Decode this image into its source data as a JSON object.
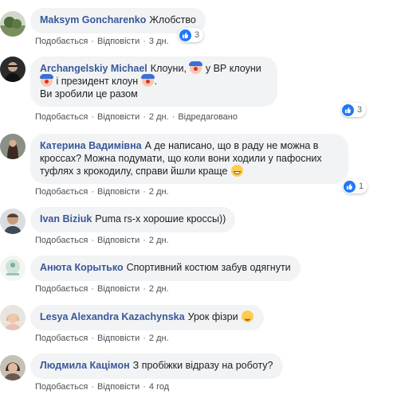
{
  "comments": [
    {
      "author": "Maksym Goncharenko",
      "text": "Жлобство",
      "like_label": "Подобається",
      "reply_label": "Відповісти",
      "time": "3 дн.",
      "reaction_count": "3"
    },
    {
      "author": "Archangelskiy Michael",
      "text_parts": [
        "Клоуни, ",
        " у ВР клоуни ",
        " і президент клоун ",
        "."
      ],
      "text_line2": "Ви зробили це разом",
      "like_label": "Подобається",
      "reply_label": "Відповісти",
      "time": "2 дн.",
      "edited_label": "Відредаговано",
      "reaction_count": "3"
    },
    {
      "author": "Катерина Вадимівна",
      "text": "А де написано, що в раду не можна в кроссах? Можна подумати, що коли вони ходили у пафосних туфлях з крокодилу, справи йшли краще",
      "like_label": "Подобається",
      "reply_label": "Відповісти",
      "time": "2 дн.",
      "reaction_count": "1"
    },
    {
      "author": "Ivan Biziuk",
      "text": "Puma rs-x хорошие кроссы))",
      "like_label": "Подобається",
      "reply_label": "Відповісти",
      "time": "2 дн."
    },
    {
      "author": "Анюта Корытько",
      "text": "Спортивний костюм забув одягнути",
      "like_label": "Подобається",
      "reply_label": "Відповісти",
      "time": "2 дн."
    },
    {
      "author": "Lesya Alexandra Kazachynska",
      "text": "Урок фізри",
      "like_label": "Подобається",
      "reply_label": "Відповісти",
      "time": "2 дн."
    },
    {
      "author": "Людмила Кацімон",
      "text": "З пробіжки відразу на роботу?",
      "like_label": "Подобається",
      "reply_label": "Відповісти",
      "time": "4 год"
    }
  ],
  "colors": {
    "author": "#385898",
    "bubble": "#f2f3f5",
    "like_badge": "#2078f4",
    "meta": "#606770"
  },
  "icons": {
    "reaction": "thumbs-up-icon",
    "clown": "clown-face-emoji",
    "laugh": "grinning-sweat-emoji",
    "smile": "smiling-face-emoji"
  }
}
